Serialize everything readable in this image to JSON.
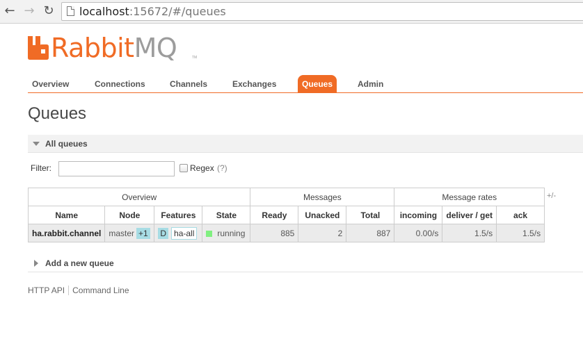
{
  "browser": {
    "url_host": "localhost",
    "url_rest": ":15672/#/queues"
  },
  "logo": {
    "brand_rabbit": "Rabbit",
    "brand_mq": "MQ",
    "trademark": "TM",
    "colors": {
      "orange": "#f06b25",
      "grey": "#9c9c9c"
    }
  },
  "tabs": [
    {
      "label": "Overview",
      "active": false
    },
    {
      "label": "Connections",
      "active": false
    },
    {
      "label": "Channels",
      "active": false
    },
    {
      "label": "Exchanges",
      "active": false
    },
    {
      "label": "Queues",
      "active": true
    },
    {
      "label": "Admin",
      "active": false
    }
  ],
  "page_title": "Queues",
  "all_queues": {
    "label": "All queues",
    "filter_label": "Filter:",
    "filter_value": "",
    "regex_label": "Regex",
    "regex_help": "(?)",
    "regex_checked": false
  },
  "table": {
    "groups": [
      "Overview",
      "Messages",
      "Message rates"
    ],
    "columns": [
      "Name",
      "Node",
      "Features",
      "State",
      "Ready",
      "Unacked",
      "Total",
      "incoming",
      "deliver / get",
      "ack"
    ],
    "toggle_columns": "+/-",
    "rows": [
      {
        "name": "ha.rabbit.channel",
        "node": "master",
        "node_extra": "+1",
        "feature_durable": "D",
        "feature_policy": "ha-all",
        "state": "running",
        "ready": "885",
        "unacked": "2",
        "total": "887",
        "incoming": "0.00/s",
        "deliver_get": "1.5/s",
        "ack": "1.5/s"
      }
    ]
  },
  "add_queue": {
    "label": "Add a new queue"
  },
  "footer": {
    "http_api": "HTTP API",
    "command_line": "Command Line"
  },
  "colors": {
    "accent": "#f06b25",
    "running": "#80f080",
    "pill": "#a7dce4"
  }
}
